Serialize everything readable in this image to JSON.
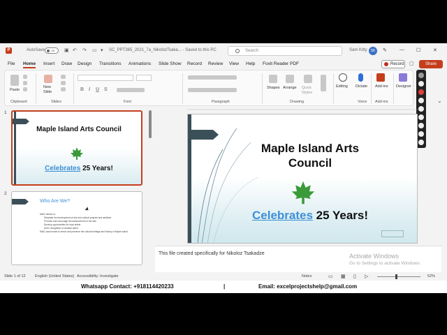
{
  "titlebar": {
    "autosave_label": "AutoSave",
    "autosave_state": "Off",
    "document": "SC_PPT365_2021_7a_NikolozTsaka... - Saved to this PC",
    "search_placeholder": "Search",
    "user_name": "Sam Kitty",
    "user_initials": "SK"
  },
  "menu": {
    "tabs": [
      "File",
      "Home",
      "Insert",
      "Draw",
      "Design",
      "Transitions",
      "Animations",
      "Slide Show",
      "Record",
      "Review",
      "View",
      "Help",
      "Foxit Reader PDF"
    ],
    "active": "Home",
    "record_label": "Record",
    "share_label": "Share"
  },
  "ribbon": {
    "groups": [
      "Clipboard",
      "Slides",
      "Font",
      "Paragraph",
      "Drawing",
      "Voice",
      "Add-ins"
    ],
    "buttons": {
      "paste": "Paste",
      "new_slide": "New Slide",
      "shapes": "Shapes",
      "arrange": "Arrange",
      "quick_styles": "Quick Styles",
      "editing": "Editing",
      "dictate": "Dictate",
      "add_ins": "Add-ins",
      "designer": "Designer"
    }
  },
  "thumbnails": [
    {
      "number": "1",
      "title": "Maple Island Arts Council",
      "subtitle_highlight": "Celebrates",
      "subtitle_rest": " 25 Years!"
    },
    {
      "number": "2",
      "title": "Who Are We?",
      "bullets": [
        "MIAC strives to:",
        "Stimulate the development of arts and cultural projects and activities",
        "Promote and encourage the advancement of the arts",
        "Develop opportunities for local artists",
        "Aid in recognition of creative talent",
        "MIAC was formed to enrich and preserve the cultural heritage and history of Maple Island"
      ]
    }
  ],
  "slide": {
    "title_line1": "Maple Island Arts",
    "title_line2": "Council",
    "subtitle_highlight": "Celebrates",
    "subtitle_rest": " 25 Years!"
  },
  "notes": "This file created specifically for Nikoloz Tsakadze",
  "activation": {
    "line1": "Activate Windows",
    "line2": "Go to Settings to activate Windows."
  },
  "status": {
    "slide": "Slide 1 of 12",
    "language": "English (United States)",
    "accessibility": "Accessibility: Investigate",
    "notes": "Notes",
    "zoom": "52%"
  },
  "contact": {
    "whatsapp": "Whatsapp Contact: +918114420233",
    "divider": "|",
    "email": "Email: excelprojectshelp@gmail.com"
  },
  "colors": {
    "accent": "#c43e1c",
    "slide_dark": "#3b4f58",
    "link_blue": "#3d8fd6",
    "maple_green": "#3a9a3a"
  }
}
